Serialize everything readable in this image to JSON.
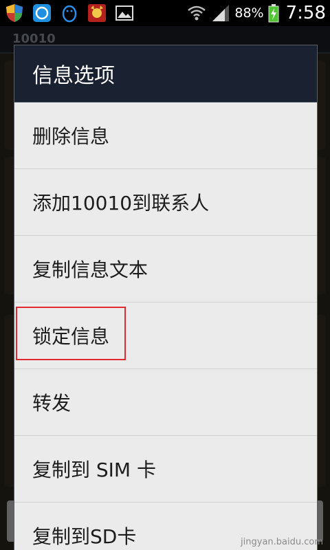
{
  "status_bar": {
    "battery_percent": "88%",
    "time": "7:58",
    "icons": [
      "shield-icon",
      "blue-app-icon",
      "qq-penguin-icon",
      "mascot-app-icon",
      "gallery-image-icon",
      "wifi-icon",
      "signal-icon",
      "battery-charging-icon"
    ]
  },
  "conversation": {
    "title": "10010"
  },
  "dialog": {
    "title": "信息选项",
    "items": [
      {
        "label": "删除信息"
      },
      {
        "label": "添加10010到联系人"
      },
      {
        "label": "复制信息文本"
      },
      {
        "label": "锁定信息"
      },
      {
        "label": "转发"
      },
      {
        "label": "复制到 SIM 卡"
      },
      {
        "label": "复制到SD卡"
      }
    ]
  },
  "watermark": {
    "text": "jingyan.baidu.com"
  },
  "colors": {
    "dialog_header_bg": "#1a2131",
    "menu_bg": "#ebebeb",
    "highlight": "#e0282e"
  }
}
